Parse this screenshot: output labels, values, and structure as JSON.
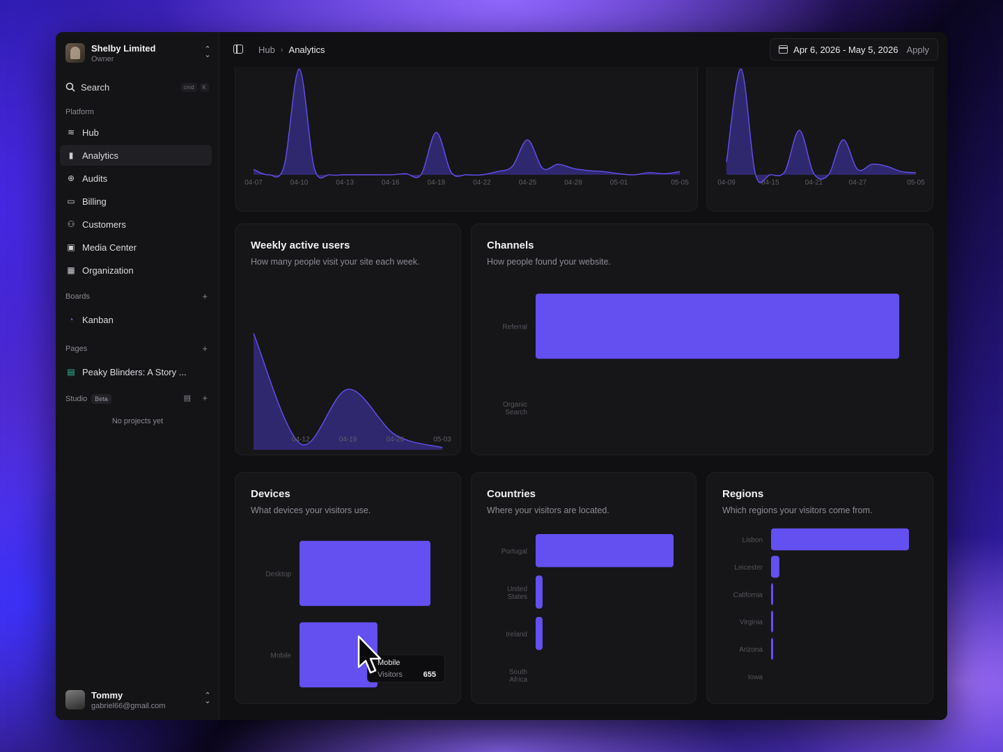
{
  "sidebar": {
    "org_name": "Shelby Limited",
    "org_role": "Owner",
    "search_label": "Search",
    "search_kbd": [
      "cmd",
      "K"
    ],
    "platform_label": "Platform",
    "platform_items": [
      {
        "label": "Hub",
        "icon": "layers-icon"
      },
      {
        "label": "Analytics",
        "icon": "bar-chart-icon"
      },
      {
        "label": "Audits",
        "icon": "search-zoom-icon"
      },
      {
        "label": "Billing",
        "icon": "credit-card-icon"
      },
      {
        "label": "Customers",
        "icon": "users-icon"
      },
      {
        "label": "Media Center",
        "icon": "images-icon"
      },
      {
        "label": "Organization",
        "icon": "building-icon"
      }
    ],
    "boards_label": "Boards",
    "boards_items": [
      {
        "label": "Kanban",
        "icon": "kanban-icon"
      }
    ],
    "pages_label": "Pages",
    "pages_items": [
      {
        "label": "Peaky Blinders: A Story ...",
        "icon": "page-icon"
      }
    ],
    "studio_label": "Studio",
    "studio_badge": "Beta",
    "no_projects": "No projects yet",
    "user_name": "Tommy",
    "user_email": "gabriel66@gmail.com",
    "accent": "#6450f0"
  },
  "header": {
    "breadcrumb_root": "Hub",
    "breadcrumb_current": "Analytics",
    "date_range": "Apr 6, 2026 - May 5, 2026",
    "apply_label": "Apply"
  },
  "cards": {
    "weekly": {
      "title": "Weekly active users",
      "subtitle": "How many people visit your site each week."
    },
    "channels": {
      "title": "Channels",
      "subtitle": "How people found your website."
    },
    "devices": {
      "title": "Devices",
      "subtitle": "What devices your visitors use."
    },
    "countries": {
      "title": "Countries",
      "subtitle": "Where your visitors are located."
    },
    "regions": {
      "title": "Regions",
      "subtitle": "Which regions your visitors come from."
    }
  },
  "tooltip": {
    "label": "Mobile",
    "metric": "Visitors",
    "value": "655"
  },
  "chart_data": [
    {
      "type": "area",
      "x": [
        "04-07",
        "04-08",
        "04-09",
        "04-10",
        "04-11",
        "04-12",
        "04-13",
        "04-14",
        "04-15",
        "04-16",
        "04-17",
        "04-18",
        "04-19",
        "04-20",
        "04-21",
        "04-22",
        "04-23",
        "04-24",
        "04-25",
        "04-26",
        "04-27",
        "04-28",
        "04-29",
        "04-30",
        "05-01",
        "05-02",
        "05-03",
        "05-04",
        "05-05"
      ],
      "x_tick_labels": [
        "04-07",
        "04-10",
        "04-13",
        "04-16",
        "04-19",
        "04-22",
        "04-25",
        "04-28",
        "05-01",
        "05-05"
      ],
      "values": [
        5,
        0,
        8,
        100,
        6,
        0,
        0,
        0,
        0,
        0,
        1,
        0,
        40,
        2,
        0,
        0,
        3,
        8,
        33,
        6,
        10,
        6,
        4,
        3,
        1,
        0,
        2,
        1,
        3
      ],
      "ylim": [
        0,
        100
      ]
    },
    {
      "type": "area",
      "x": [
        "04-09",
        "04-11",
        "04-13",
        "04-15",
        "04-17",
        "04-19",
        "04-21",
        "04-23",
        "04-25",
        "04-27",
        "04-29",
        "05-01",
        "05-03",
        "05-05"
      ],
      "x_tick_labels": [
        "04-09",
        "04-15",
        "04-21",
        "04-27",
        "05-05"
      ],
      "values": [
        12,
        100,
        0,
        0,
        3,
        42,
        1,
        0,
        33,
        5,
        10,
        8,
        3,
        2
      ],
      "ylim": [
        0,
        100
      ]
    },
    {
      "type": "area",
      "x": [
        "04-05",
        "04-12",
        "04-19",
        "04-26",
        "05-03"
      ],
      "x_tick_labels": [
        "04-12",
        "04-19",
        "04-26",
        "05-03"
      ],
      "values": [
        100,
        5,
        52,
        13,
        2
      ],
      "ylim": [
        0,
        110
      ]
    },
    {
      "type": "bar",
      "orientation": "horizontal",
      "categories": [
        "Referral",
        "Organic Search"
      ],
      "values": [
        100,
        0
      ]
    },
    {
      "type": "bar",
      "orientation": "horizontal",
      "categories": [
        "Desktop",
        "Mobile"
      ],
      "values": [
        1100,
        655
      ]
    },
    {
      "type": "bar",
      "orientation": "horizontal",
      "categories": [
        "Portugal",
        "United States",
        "Ireland",
        "South Africa"
      ],
      "values": [
        100,
        5,
        5,
        0
      ]
    },
    {
      "type": "bar",
      "orientation": "horizontal",
      "categories": [
        "Lisbon",
        "Leicester",
        "California",
        "Virginia",
        "Arizona",
        "Iowa"
      ],
      "values": [
        100,
        6,
        1,
        1,
        1,
        0
      ]
    }
  ]
}
